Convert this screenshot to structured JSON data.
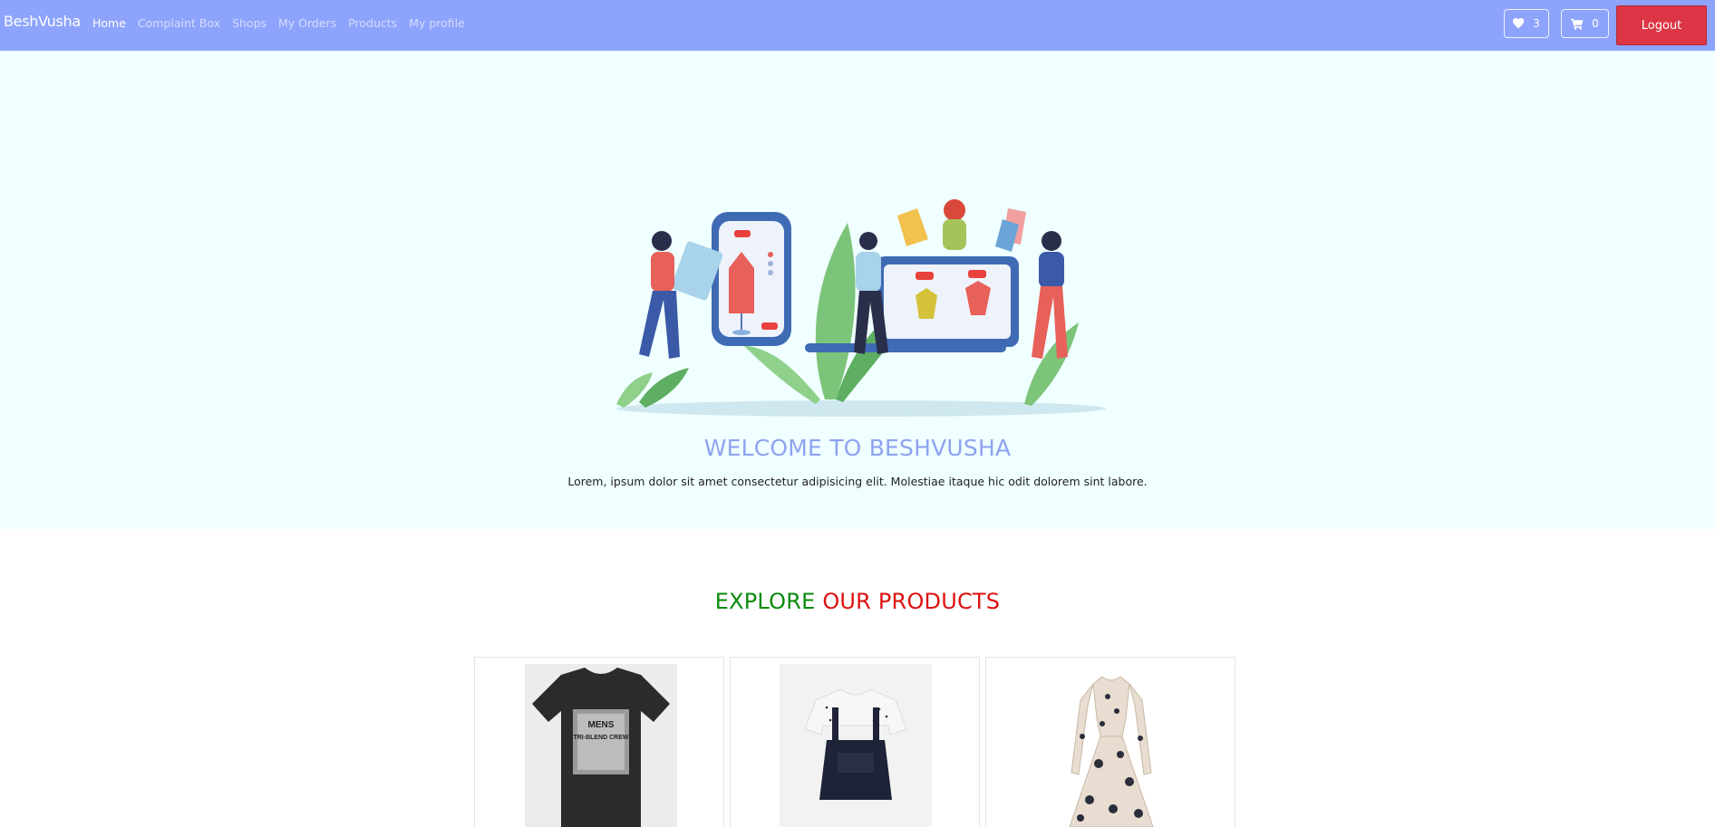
{
  "navbar": {
    "brand": "BeshVusha",
    "links": [
      {
        "label": "Home",
        "active": true
      },
      {
        "label": "Complaint Box"
      },
      {
        "label": "Shops"
      },
      {
        "label": "My Orders"
      },
      {
        "label": "Products"
      },
      {
        "label": "My profile"
      }
    ],
    "wishlist": {
      "icon": "heart-icon",
      "count": "3"
    },
    "cart": {
      "icon": "cart-icon",
      "count": "0"
    },
    "logout_label": "Logout"
  },
  "hero": {
    "title": "WELCOME TO BESHVUSHA",
    "text": "Lorem, ipsum dolor sit amet consectetur adipisicing elit. Molestiae itaque hic odit dolorem sint labore."
  },
  "products_section": {
    "title_part1": "EXPLORE",
    "title_part2": "OUR PRODUCTS",
    "products": [
      {
        "image": "black-tshirt-image",
        "shirt_text": [
          "MENS",
          "TRI-BLEND CREW"
        ]
      },
      {
        "image": "kids-dungaree-image"
      },
      {
        "image": "floral-dress-image"
      }
    ]
  },
  "colors": {
    "navbar": "#8ea3fc",
    "hero_bg": "#f0ffff",
    "logout": "#dc3545",
    "title_green": "#0a8a0a",
    "title_red": "#dd1111"
  }
}
